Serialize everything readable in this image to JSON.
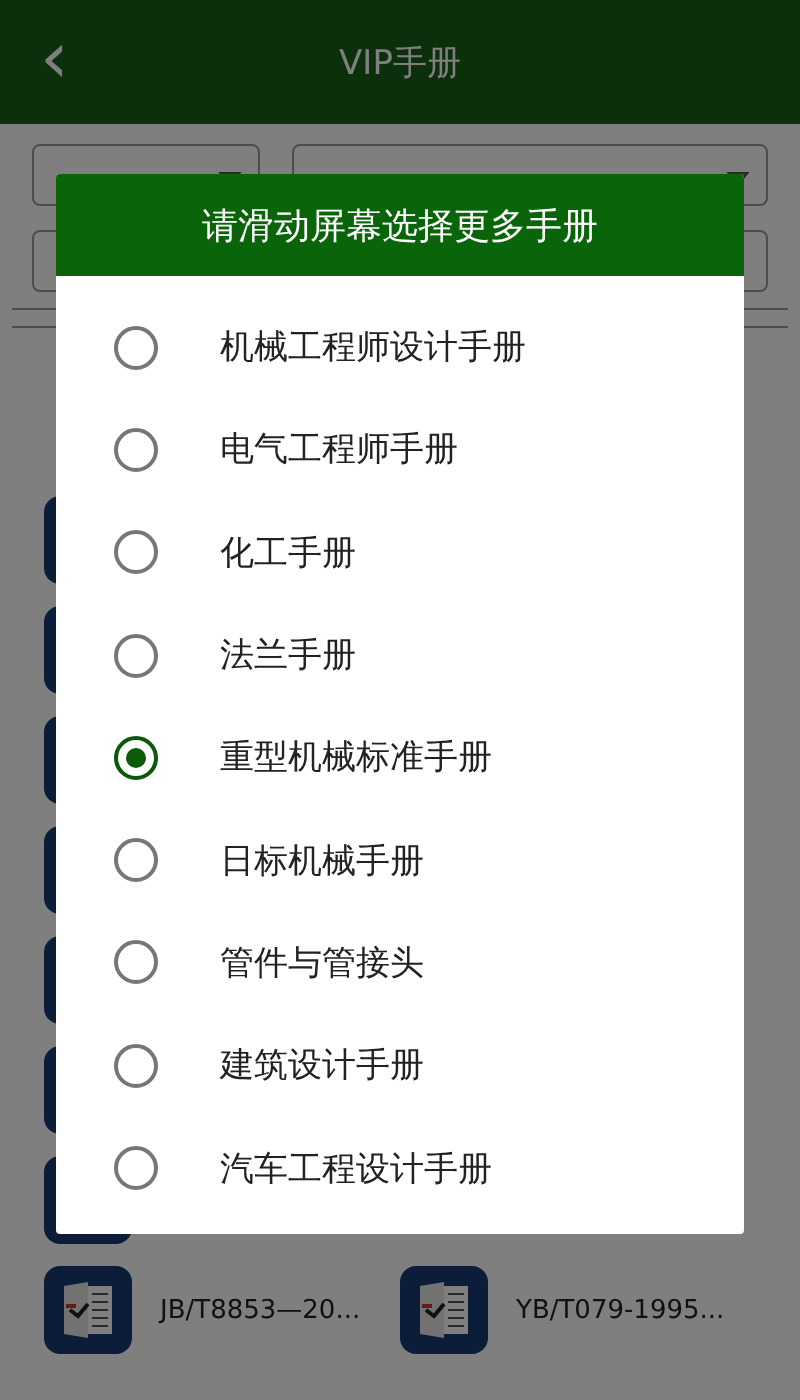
{
  "header": {
    "back": "‹",
    "title": "VIP手册"
  },
  "documents": [
    {
      "title": "JB/T8853—20..."
    },
    {
      "title": "YB/T079-1995..."
    }
  ],
  "dialog": {
    "title": "请滑动屏幕选择更多手册",
    "options": [
      {
        "label": "机械工程师设计手册",
        "selected": false
      },
      {
        "label": "电气工程师手册",
        "selected": false
      },
      {
        "label": "化工手册",
        "selected": false
      },
      {
        "label": "法兰手册",
        "selected": false
      },
      {
        "label": "重型机械标准手册",
        "selected": true
      },
      {
        "label": "日标机械手册",
        "selected": false
      },
      {
        "label": "管件与管接头",
        "selected": false
      },
      {
        "label": "建筑设计手册",
        "selected": false
      },
      {
        "label": "汽车工程设计手册",
        "selected": false
      }
    ]
  }
}
